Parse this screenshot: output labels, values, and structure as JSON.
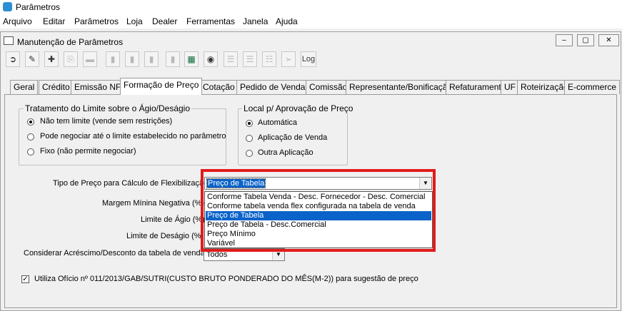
{
  "app": {
    "title": "Parâmetros"
  },
  "menu": [
    "Arquivo",
    "Editar",
    "Parâmetros",
    "Loja",
    "Dealer",
    "Ferramentas",
    "Janela",
    "Ajuda"
  ],
  "window": {
    "title": "Manutenção de Parâmetros",
    "log_label": "Log"
  },
  "tabs": [
    "Geral",
    "Crédito",
    "Emissão NF",
    "Formação de Preço",
    "Cotação",
    "Pedido de Venda",
    "Comissão",
    "Representante/Bonificação",
    "Refaturamento",
    "UF",
    "Roteirização",
    "E-commerce"
  ],
  "active_tab": "Formação de Preço",
  "limit_group": {
    "title": "Tratamento do Limite sobre o Ágio/Deságio",
    "options": [
      "Não tem limite (vende sem restrições)",
      "Pode negociar até o limite estabelecido no parâmetro",
      "Fixo (não permite negociar)"
    ],
    "selected": 0
  },
  "approval_group": {
    "title": "Local p/ Aprovação de Preço",
    "options": [
      "Automática",
      "Aplicação de Venda",
      "Outra Aplicação"
    ],
    "selected": 0
  },
  "fields": {
    "price_type_label": "Tipo de Preço para Cálculo de Flexibilização",
    "price_type_value": "Preço de Tabela",
    "margin_label": "Margem Mínina Negativa (%)",
    "agio_label": "Limite de Ágio (%)",
    "desagio_label": "Limite de Deságio (%)",
    "consider_label": "Considerar Acréscimo/Desconto da tabela de venda",
    "consider_value": "Todos"
  },
  "dropdown_options": [
    "Conforme Tabela Venda - Desc. Fornecedor - Desc. Comercial",
    "Conforme tabela venda flex configurada na tabela de venda",
    "Preço de Tabela",
    "Preço de Tabela - Desc.Comercial",
    "Preço Mínimo",
    "Variável"
  ],
  "dropdown_selected": 2,
  "checkbox": {
    "label": "Utiliza Ofício nº 011/2013/GAB/SUTRI(CUSTO BRUTO PONDERADO DO MÊS(M-2)) para sugestão de preço",
    "checked": true
  },
  "colors": {
    "highlight": "#e21b1b",
    "selection": "#0a63c9"
  }
}
